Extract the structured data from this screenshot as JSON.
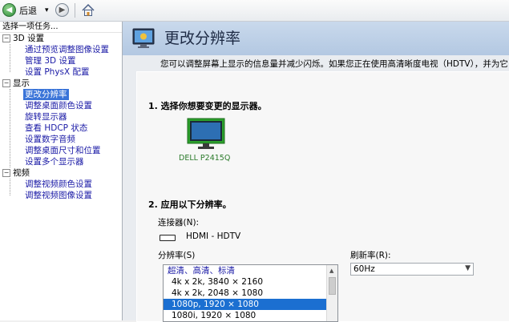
{
  "toolbar": {
    "back_label": "后退",
    "dropdown_glyph": "▾"
  },
  "tree": {
    "title": "选择一项任务...",
    "groups": [
      {
        "label": "3D 设置",
        "items": [
          "通过预览调整图像设置",
          "管理 3D 设置",
          "设置 PhysX 配置"
        ]
      },
      {
        "label": "显示",
        "items": [
          "更改分辨率",
          "调整桌面颜色设置",
          "旋转显示器",
          "查看 HDCP 状态",
          "设置数字音频",
          "调整桌面尺寸和位置",
          "设置多个显示器"
        ]
      },
      {
        "label": "视频",
        "items": [
          "调整视频颜色设置",
          "调整视频图像设置"
        ]
      }
    ],
    "expander": "−"
  },
  "page": {
    "title": "更改分辨率",
    "description": "您可以调整屏幕上显示的信息量并减少闪烁。如果您正在使用高清晰度电视（HDTV），并为它",
    "step1": "1. 选择你想要变更的显示器。",
    "monitor_name": "DELL P2415Q",
    "step2": "2. 应用以下分辨率。",
    "connector_label": "连接器(N):",
    "connector_value": "HDMI - HDTV",
    "resolution_label": "分辨率(S)",
    "refresh_label": "刷新率(R):",
    "refresh_value": "60Hz",
    "resolution_header": "超清、高清、标清",
    "resolutions": [
      "4k x 2k, 3840 × 2160",
      "4k x 2k, 2048 × 1080",
      "1080p, 1920 × 1080",
      "1080i, 1920 × 1080"
    ]
  },
  "colors": {
    "accent": "#3a74d8",
    "banner": "#b3c8e2",
    "selection": "#1b6fd1"
  }
}
